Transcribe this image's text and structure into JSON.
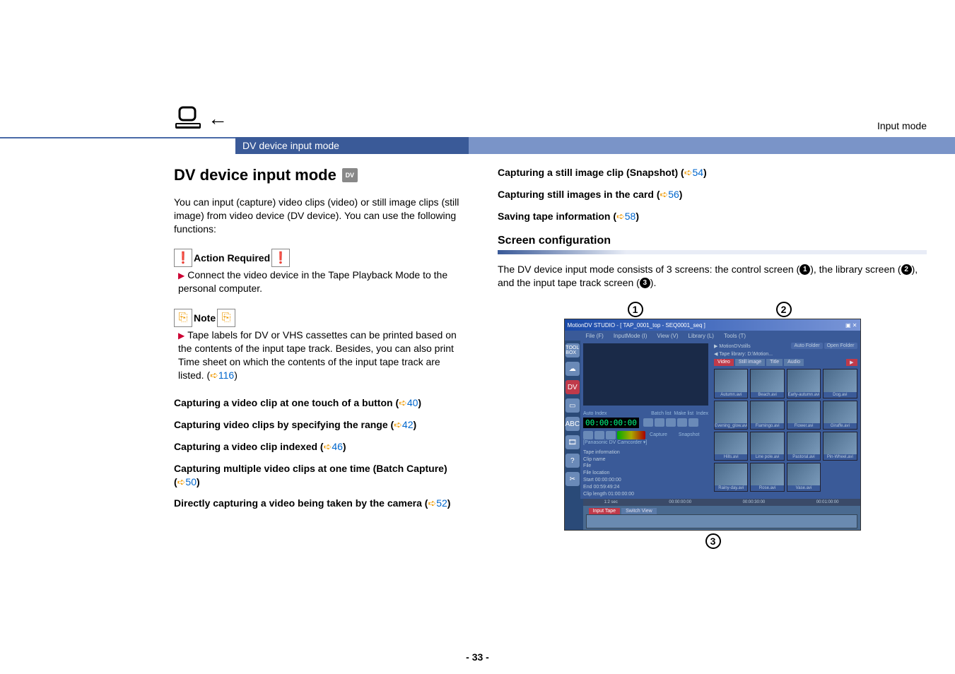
{
  "header": {
    "mode_label": "Input mode",
    "bar_title": "DV device input mode"
  },
  "left": {
    "title": "DV device input mode",
    "intro": "You can input (capture) video clips (video) or still image clips (still image) from video device (DV device). You can use the following functions:",
    "action_label": "Action Required",
    "action_text": "Connect the video device in the Tape Playback Mode to the personal computer.",
    "note_label": "Note",
    "note_text_1": "Tape labels for DV or VHS cassettes can be printed based on the contents of the input tape track. Besides, you can also print Time sheet on which the contents of the input tape track are listed. (",
    "note_ref": "116",
    "note_text_2": ")",
    "links": [
      {
        "text": "Capturing a video clip at one touch of a button (",
        "ref": "40",
        "tail": ")"
      },
      {
        "text": "Capturing video clips by specifying the range (",
        "ref": "42",
        "tail": ")"
      },
      {
        "text": "Capturing a video clip indexed (",
        "ref": "46",
        "tail": ")"
      },
      {
        "text": "Capturing multiple video clips at one time (Batch Capture) (",
        "ref": "50",
        "tail": ")"
      },
      {
        "text": "Directly capturing a video being taken by the camera (",
        "ref": "52",
        "tail": ")"
      }
    ]
  },
  "right": {
    "links": [
      {
        "text": "Capturing a still image clip (Snapshot) (",
        "ref": "54",
        "tail": ")"
      },
      {
        "text": "Capturing still images in the card (",
        "ref": "56",
        "tail": ")"
      },
      {
        "text": "Saving tape information (",
        "ref": "58",
        "tail": ")"
      }
    ],
    "section_heading": "Screen configuration",
    "config_text_1": "The DV device input mode consists of 3 screens: the control screen (",
    "n1": "1",
    "config_text_2": "), the library screen (",
    "n2": "2",
    "config_text_3": "), and the input tape track screen (",
    "n3": "3",
    "config_text_4": ")."
  },
  "shot": {
    "title": "MotionDV STUDIO - [ TAP_0001_top - SEQ0001_seq ]",
    "menu": [
      "File (F)",
      "InputMode (I)",
      "View (V)",
      "Library (L)",
      "Tools (T)"
    ],
    "lib_header_left": "MotionDVstills",
    "lib_header_btns": [
      "Auto Folder",
      "Open Folder"
    ],
    "lib_path": "Tape library: D:\\Motion...",
    "tabs": [
      "Video",
      "Still image",
      "Title",
      "Audio"
    ],
    "thumbs": [
      "Autumn.avi",
      "Beach.avi",
      "Early-autumn.avi",
      "Dog.avi",
      "Evening_glow.avi",
      "Flamingo.avi",
      "Flower.avi",
      "Giraffe.avi",
      "Hills.avi",
      "Line pole.avi",
      "Pastoral.avi",
      "Pin-Wheel.avi",
      "Rainy-day.avi",
      "Rose.avi",
      "Vase.avi"
    ],
    "transport_label": "Auto Index",
    "transport_right": [
      "Batch list",
      "Make list",
      "Index"
    ],
    "counter": "00:00:00:00",
    "row_btns": [
      "Capture",
      "Snapshot"
    ],
    "device_row": "[Panasonic DV Camcorder ▾]",
    "tapeinfo_title": "Tape information",
    "tapeinfo": [
      "Clip name",
      "File",
      "File location",
      "Start        00:00:00:00",
      "End          00:59:49:24",
      "Clip length  01:00:00:00"
    ],
    "bottom_zoom": "1:2 sec",
    "time_ticks": [
      "00:00:00:00",
      "00:00:30:00",
      "00:01:00:00"
    ],
    "bottom_tabs": [
      "Input Tape",
      "Switch View"
    ]
  },
  "page_number": "- 33 -"
}
